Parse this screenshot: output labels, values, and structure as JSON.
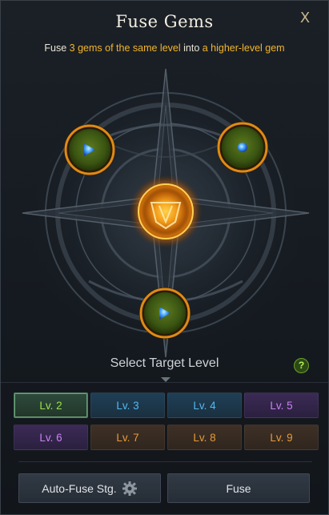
{
  "window": {
    "title": "Fuse Gems",
    "close_glyph": "X"
  },
  "subtitle": {
    "part1": "Fuse ",
    "highlight1": "3 gems of the same level",
    "part2": " into ",
    "highlight2": "a higher-level gem"
  },
  "slots": {
    "top_left": {
      "icon": "blue-gem-icon"
    },
    "top_right": {
      "icon": "blue-gem-icon"
    },
    "bottom": {
      "icon": "blue-gem-icon"
    },
    "center": {
      "icon": "fusion-crest-icon"
    }
  },
  "target_level": {
    "label": "Select Target Level",
    "help_glyph": "?",
    "selected": "Lv. 2",
    "levels": [
      {
        "label": "Lv. 2",
        "tier": "green"
      },
      {
        "label": "Lv. 3",
        "tier": "blue"
      },
      {
        "label": "Lv. 4",
        "tier": "blue"
      },
      {
        "label": "Lv. 5",
        "tier": "purple"
      },
      {
        "label": "Lv. 6",
        "tier": "purple"
      },
      {
        "label": "Lv. 7",
        "tier": "orange"
      },
      {
        "label": "Lv. 8",
        "tier": "orange"
      },
      {
        "label": "Lv. 9",
        "tier": "orange"
      }
    ]
  },
  "buttons": {
    "auto_fuse_label": "Auto-Fuse Stg.",
    "fuse_label": "Fuse"
  },
  "colors": {
    "highlight": "#f2b52a",
    "green_tier": "#9be34a",
    "blue_tier": "#55b8f0",
    "purple_tier": "#c882f2",
    "orange_tier": "#e69a3a"
  }
}
